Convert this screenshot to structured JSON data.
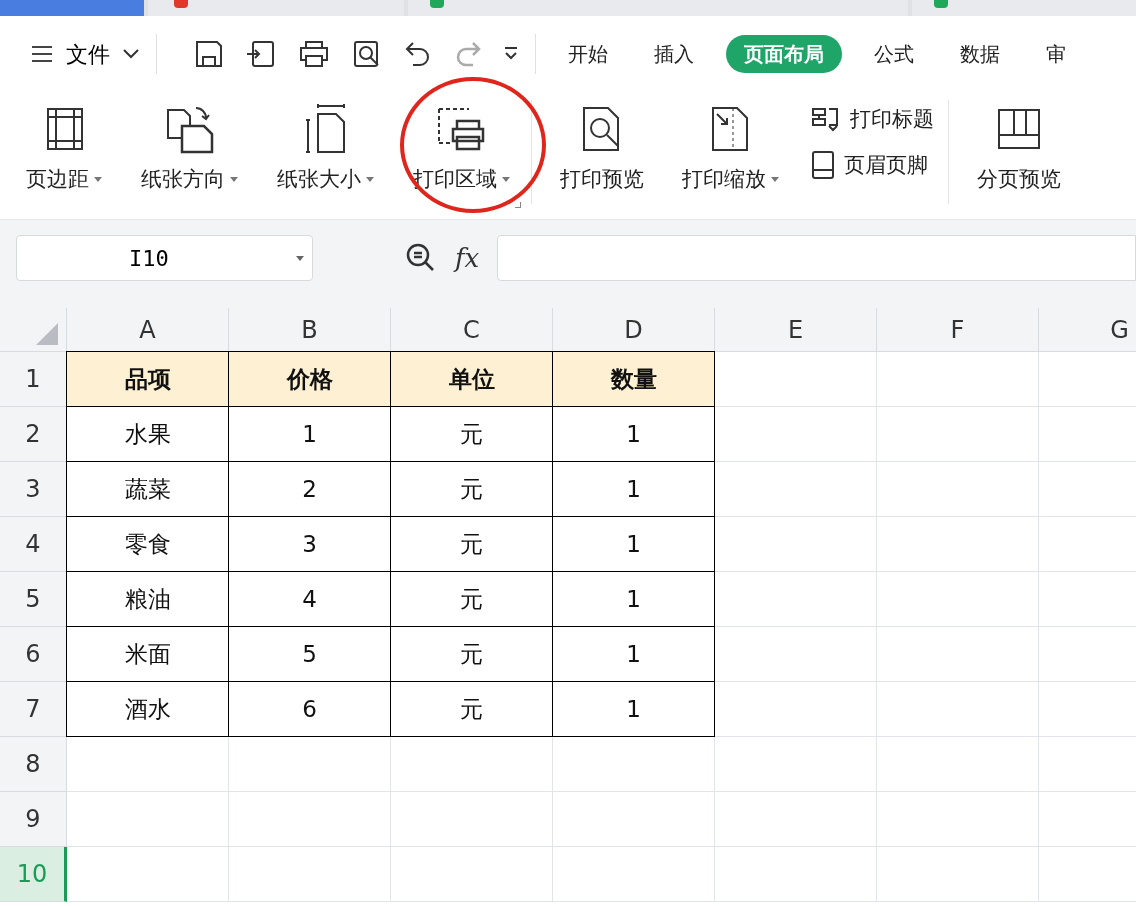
{
  "document_tabs": [
    {
      "selected": true
    },
    {
      "selected": false
    },
    {
      "selected": false
    },
    {
      "selected": false
    }
  ],
  "toolbar": {
    "file_menu": "文件",
    "tabs": [
      {
        "label": "开始",
        "selected": false
      },
      {
        "label": "插入",
        "selected": false
      },
      {
        "label": "页面布局",
        "selected": true
      },
      {
        "label": "公式",
        "selected": false
      },
      {
        "label": "数据",
        "selected": false
      },
      {
        "label": "审",
        "selected": false
      }
    ]
  },
  "ribbon": [
    {
      "kind": "large",
      "label": "页边距",
      "dropdown": true
    },
    {
      "kind": "large",
      "label": "纸张方向",
      "dropdown": true
    },
    {
      "kind": "large",
      "label": "纸张大小",
      "dropdown": true
    },
    {
      "kind": "large",
      "label": "打印区域",
      "dropdown": true
    },
    {
      "kind": "large",
      "label": "打印预览",
      "dropdown": false
    },
    {
      "kind": "large",
      "label": "打印缩放",
      "dropdown": true
    },
    {
      "kind": "stack",
      "items": [
        "打印标题",
        "页眉页脚"
      ]
    },
    {
      "kind": "large",
      "label": "分页预览",
      "dropdown": false
    }
  ],
  "formula_bar": {
    "name_box": "I10",
    "fx": "fx"
  },
  "sheet": {
    "columns": [
      "A",
      "B",
      "C",
      "D",
      "E",
      "F",
      "G"
    ],
    "rows": [
      {
        "number": "1",
        "selected": false,
        "cells": [
          "品项",
          "价格",
          "单位",
          "数量"
        ]
      },
      {
        "number": "2",
        "selected": false,
        "cells": [
          "水果",
          "1",
          "元",
          "1"
        ]
      },
      {
        "number": "3",
        "selected": false,
        "cells": [
          "蔬菜",
          "2",
          "元",
          "1"
        ]
      },
      {
        "number": "4",
        "selected": false,
        "cells": [
          "零食",
          "3",
          "元",
          "1"
        ]
      },
      {
        "number": "5",
        "selected": false,
        "cells": [
          "粮油",
          "4",
          "元",
          "1"
        ]
      },
      {
        "number": "6",
        "selected": false,
        "cells": [
          "米面",
          "5",
          "元",
          "1"
        ]
      },
      {
        "number": "7",
        "selected": false,
        "cells": [
          "酒水",
          "6",
          "元",
          "1"
        ]
      },
      {
        "number": "8",
        "selected": false,
        "cells": []
      },
      {
        "number": "9",
        "selected": false,
        "cells": []
      },
      {
        "number": "10",
        "selected": true,
        "cells": []
      }
    ]
  }
}
